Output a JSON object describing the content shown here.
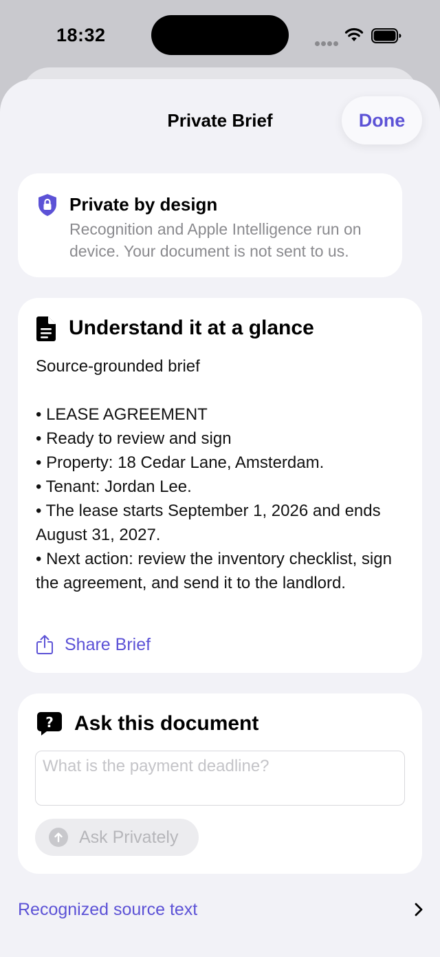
{
  "status_bar": {
    "time": "18:32"
  },
  "sheet": {
    "title": "Private Brief",
    "done_label": "Done"
  },
  "privacy_card": {
    "icon": "shield-lock-icon",
    "title": "Private by design",
    "description": "Recognition and Apple Intelligence run on device. Your document is not sent to us."
  },
  "glance_card": {
    "icon": "document-icon",
    "title": "Understand it at a glance",
    "subtitle": "Source-grounded brief",
    "bullets": [
      "• LEASE AGREEMENT",
      "• Ready to review and sign",
      "• Property: 18 Cedar Lane, Amsterdam.",
      "• Tenant: Jordan Lee.",
      "• The lease starts September 1, 2026 and ends August 31, 2027.",
      "• Next action: review the inventory checklist, sign the agreement, and send it to the landlord."
    ],
    "share_label": "Share Brief"
  },
  "ask_card": {
    "icon": "question-bubble-icon",
    "title": "Ask this document",
    "input_value": "",
    "input_placeholder": "What is the payment deadline?",
    "ask_button_label": "Ask Privately"
  },
  "source_row": {
    "label": "Recognized source text",
    "icon": "chevron-right-icon"
  },
  "colors": {
    "accent": "#5c52d6",
    "sheet_background": "#f2f2f7",
    "card_background": "#ffffff",
    "secondary_text": "#8a8a8e"
  }
}
